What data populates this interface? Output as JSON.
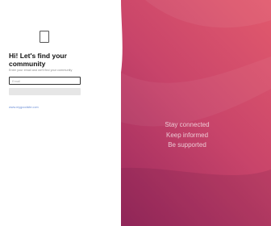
{
  "left": {
    "logo_icon": "phone-icon",
    "heading": "Hi! Let's find your community",
    "subtitle": "Enter your email and we'll find your community",
    "email": {
      "placeholder": "Email",
      "value": ""
    },
    "submit_label": "",
    "footer_link": "www.mygoodsite.com"
  },
  "hero": {
    "gradient": {
      "top_right": "#e25a6d",
      "middle": "#c8446a",
      "bottom": "#9c2a5e"
    },
    "slogan": [
      "Stay connected",
      "Keep informed",
      "Be supported"
    ]
  }
}
